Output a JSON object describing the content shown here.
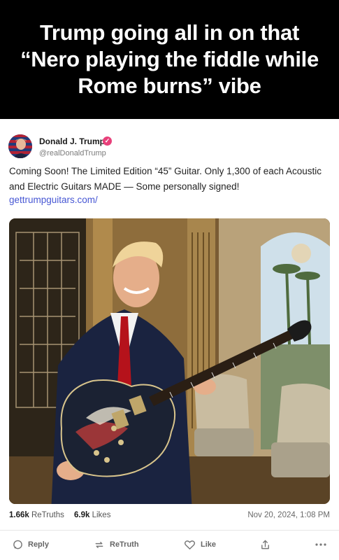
{
  "meme": {
    "caption": "Trump going all in on that “Nero playing the fiddle while Rome burns” vibe"
  },
  "post": {
    "author": {
      "display_name": "Donald J. Trump",
      "handle": "@realDonaldTrump",
      "verified": true
    },
    "text": "Coming Soon! The Limited Edition “45” Guitar. Only 1,300 of each Acoustic and Electric Guitars MADE — Some personally signed!",
    "link": "gettrumpguitars.com/",
    "stats": {
      "retruths_count": "1.66k",
      "retruths_label": "ReTruths",
      "likes_count": "6.9k",
      "likes_label": "Likes",
      "timestamp": "Nov 20, 2024, 1:08 PM"
    },
    "actions": {
      "reply": "Reply",
      "retruth": "ReTruth",
      "like": "Like",
      "share_icon": "share-icon",
      "more_icon": "more-icon"
    }
  },
  "colors": {
    "header_bg": "#000000",
    "link": "#4757d4",
    "verified_badge": "#e8407a"
  }
}
